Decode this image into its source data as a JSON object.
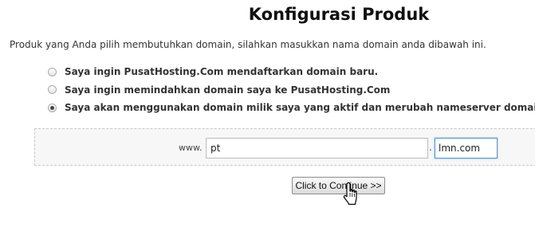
{
  "page": {
    "title": "Konfigurasi Produk",
    "intro": "Produk yang Anda pilih membutuhkan domain, silahkan masukkan nama domain anda dibawah ini."
  },
  "domain_options": [
    {
      "label": "Saya ingin PusatHosting.Com mendaftarkan domain baru.",
      "checked": false
    },
    {
      "label": "Saya ingin memindahkan domain saya ke PusatHosting.Com",
      "checked": false
    },
    {
      "label": "Saya akan menggunakan domain milik saya yang aktif dan merubah nameserver domainya.",
      "checked": true
    }
  ],
  "domain_form": {
    "prefix": "www.",
    "domain_value": "pt",
    "separator": ".",
    "tld_value": "lmn.com",
    "continue_label": "Click to Continue >>"
  },
  "icons": {
    "pointer": "hand-pointer-icon"
  }
}
